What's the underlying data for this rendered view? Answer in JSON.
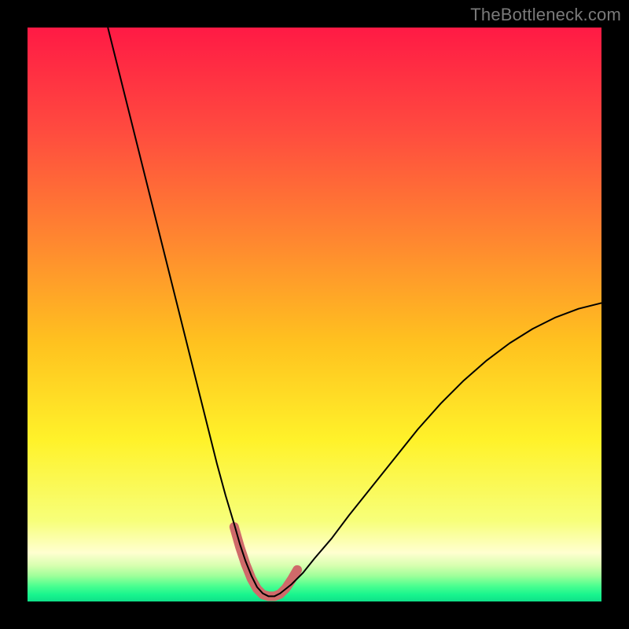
{
  "watermark": "TheBottleneck.com",
  "chart_data": {
    "type": "line",
    "title": "",
    "xlabel": "",
    "ylabel": "",
    "xlim": [
      0,
      100
    ],
    "ylim": [
      0,
      100
    ],
    "grid": false,
    "legend": false,
    "background_gradient": {
      "stops": [
        {
          "pos": 0.0,
          "color": "#ff1a45"
        },
        {
          "pos": 0.18,
          "color": "#ff4b3f"
        },
        {
          "pos": 0.38,
          "color": "#ff8a2f"
        },
        {
          "pos": 0.55,
          "color": "#ffc21f"
        },
        {
          "pos": 0.72,
          "color": "#fff22a"
        },
        {
          "pos": 0.86,
          "color": "#f7ff7a"
        },
        {
          "pos": 0.915,
          "color": "#ffffd0"
        },
        {
          "pos": 0.937,
          "color": "#d8ffb0"
        },
        {
          "pos": 0.955,
          "color": "#a0ff9a"
        },
        {
          "pos": 0.972,
          "color": "#4fff90"
        },
        {
          "pos": 0.988,
          "color": "#18f58e"
        },
        {
          "pos": 1.0,
          "color": "#0fdf88"
        }
      ]
    },
    "series": [
      {
        "name": "bottleneck-curve",
        "stroke": "#000000",
        "stroke_width": 2,
        "x": [
          14,
          16,
          18,
          20,
          22,
          24,
          26,
          28,
          30,
          31.5,
          33,
          34.5,
          36,
          37,
          38,
          39,
          40,
          41,
          42,
          43,
          44,
          46,
          48,
          50,
          53,
          56,
          60,
          64,
          68,
          72,
          76,
          80,
          84,
          88,
          92,
          96,
          100
        ],
        "y": [
          100,
          92,
          84,
          76,
          68,
          60,
          52,
          44,
          36,
          30,
          24,
          18.5,
          13.5,
          10,
          7,
          4.5,
          2.5,
          1.4,
          0.9,
          0.9,
          1.4,
          3,
          5,
          7.5,
          11,
          15,
          20,
          25,
          30,
          34.5,
          38.5,
          42,
          45,
          47.5,
          49.5,
          51,
          52
        ]
      },
      {
        "name": "valley-highlight",
        "stroke": "#cf6a6a",
        "stroke_width": 12,
        "linecap": "round",
        "x": [
          36,
          37,
          38,
          39,
          40,
          41,
          42,
          43,
          44,
          45,
          46,
          47
        ],
        "y": [
          13,
          9.5,
          6.5,
          4,
          2.2,
          1.2,
          0.9,
          0.9,
          1.3,
          2.3,
          3.8,
          5.5
        ]
      }
    ]
  }
}
